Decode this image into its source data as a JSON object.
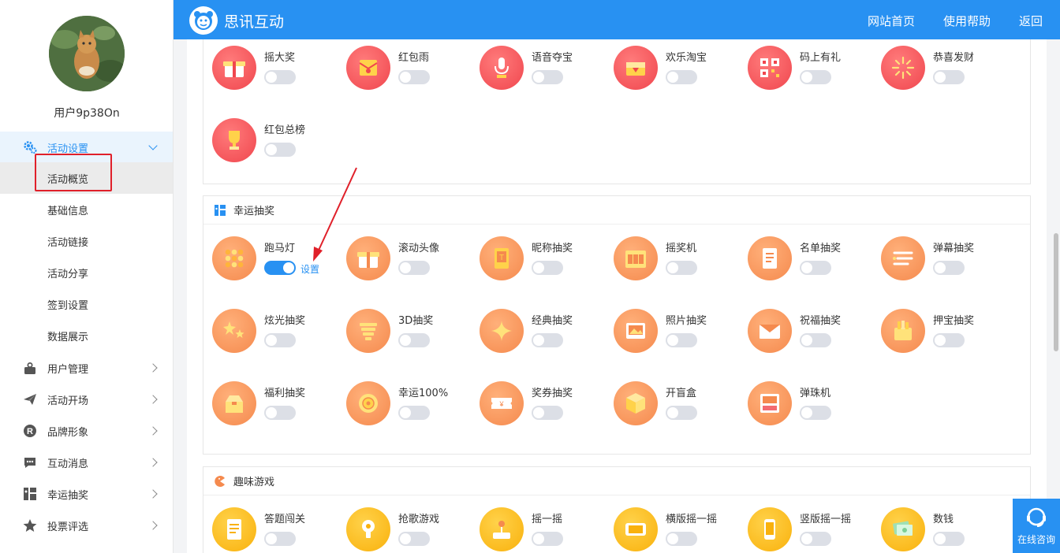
{
  "app": {
    "brand": "思讯互动"
  },
  "topnav": {
    "home": "网站首页",
    "help": "使用帮助",
    "back": "返回"
  },
  "user": {
    "name": "用户9p38On"
  },
  "sidebar": {
    "activity_settings": "活动设置",
    "sub_items": [
      "活动概览",
      "基础信息",
      "活动链接",
      "活动分享",
      "签到设置",
      "数据展示"
    ],
    "groups": [
      "用户管理",
      "活动开场",
      "品牌形象",
      "互动消息",
      "幸运抽奖",
      "投票评选"
    ]
  },
  "sections": {
    "redpacket": {
      "items": [
        {
          "name": "摇大奖",
          "icon": "gift-box-icon",
          "on": false
        },
        {
          "name": "红包雨",
          "icon": "red-envelope-icon",
          "on": false
        },
        {
          "name": "语音夺宝",
          "icon": "microphone-icon",
          "on": false
        },
        {
          "name": "欢乐淘宝",
          "icon": "treasure-chest-icon",
          "on": false
        },
        {
          "name": "码上有礼",
          "icon": "qr-code-icon",
          "on": false
        },
        {
          "name": "恭喜发财",
          "icon": "firework-icon",
          "on": false
        },
        {
          "name": "红包总榜",
          "icon": "trophy-icon",
          "on": false
        }
      ]
    },
    "lottery": {
      "title": "幸运抽奖",
      "settings_link": "设置",
      "items": [
        {
          "name": "跑马灯",
          "icon": "marquee-grid-icon",
          "on": true
        },
        {
          "name": "滚动头像",
          "icon": "gift-box-icon",
          "on": false
        },
        {
          "name": "昵称抽奖",
          "icon": "nickname-card-icon",
          "on": false
        },
        {
          "name": "摇奖机",
          "icon": "slot-machine-icon",
          "on": false
        },
        {
          "name": "名单抽奖",
          "icon": "list-document-icon",
          "on": false
        },
        {
          "name": "弹幕抽奖",
          "icon": "barrage-icon",
          "on": false
        },
        {
          "name": "炫光抽奖",
          "icon": "sparkle-stars-icon",
          "on": false
        },
        {
          "name": "3D抽奖",
          "icon": "3d-layers-icon",
          "on": false
        },
        {
          "name": "经典抽奖",
          "icon": "twinkle-icon",
          "on": false
        },
        {
          "name": "照片抽奖",
          "icon": "photo-frame-icon",
          "on": false
        },
        {
          "name": "祝福抽奖",
          "icon": "envelope-icon",
          "on": false
        },
        {
          "name": "押宝抽奖",
          "icon": "card-box-icon",
          "on": false
        },
        {
          "name": "福利抽奖",
          "icon": "open-box-icon",
          "on": false
        },
        {
          "name": "幸运100%",
          "icon": "lucky-wheel-icon",
          "on": false
        },
        {
          "name": "奖券抽奖",
          "icon": "ticket-icon",
          "on": false
        },
        {
          "name": "开盲盒",
          "icon": "blind-box-icon",
          "on": false
        },
        {
          "name": "弹珠机",
          "icon": "pinball-icon",
          "on": false
        }
      ]
    },
    "games": {
      "title": "趣味游戏",
      "items": [
        {
          "name": "答题闯关",
          "icon": "quiz-sheet-icon",
          "on": false
        },
        {
          "name": "抢歌游戏",
          "icon": "music-bulb-icon",
          "on": false
        },
        {
          "name": "摇一摇",
          "icon": "joystick-icon",
          "on": false
        },
        {
          "name": "横版摇一摇",
          "icon": "landscape-phone-icon",
          "on": false
        },
        {
          "name": "竖版摇一摇",
          "icon": "portrait-phone-icon",
          "on": false
        },
        {
          "name": "数钱",
          "icon": "money-icon",
          "on": false
        }
      ]
    }
  },
  "consult": {
    "label": "在线咨询"
  }
}
